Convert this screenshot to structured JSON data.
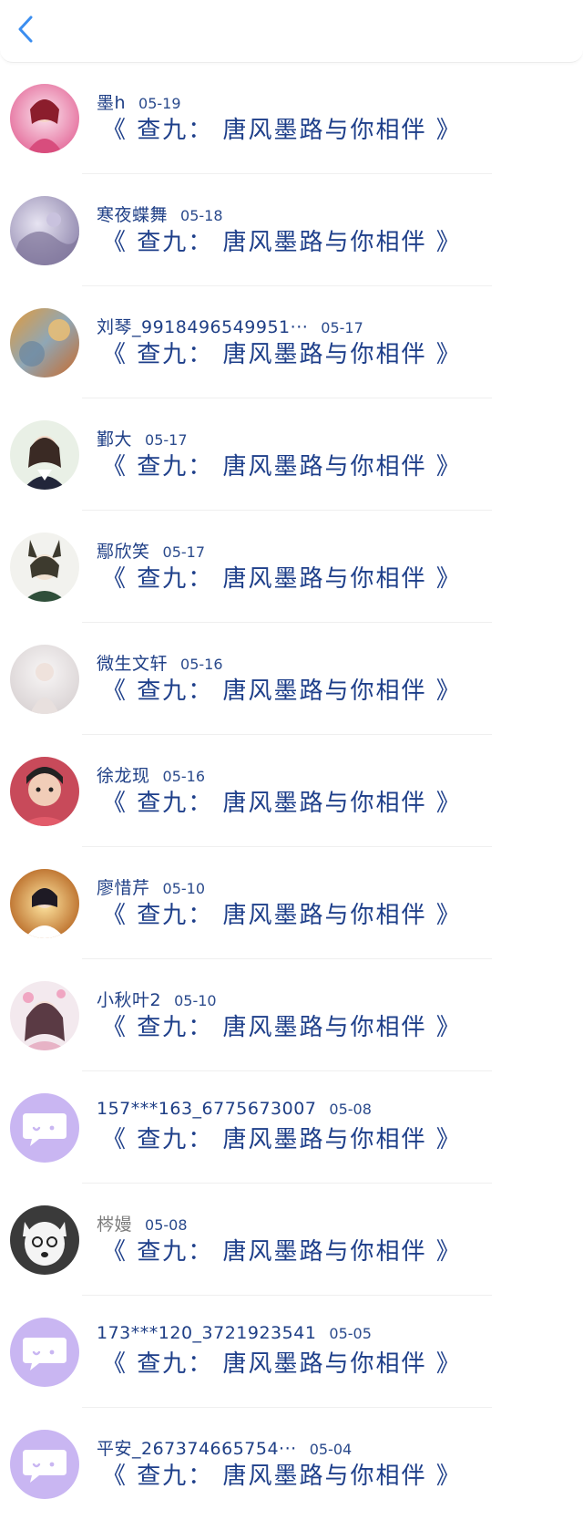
{
  "header": {
    "back_icon": "chevron-left-icon",
    "accent_color": "#3b8ef0"
  },
  "items": [
    {
      "name": "墨h",
      "date": "05-19",
      "title": "《 查九： 唐风墨路与你相伴 》",
      "avatar": "photo-pink"
    },
    {
      "name": "寒夜蝶舞",
      "date": "05-18",
      "title": "《 查九： 唐风墨路与你相伴 》",
      "avatar": "photo-lavender"
    },
    {
      "name": "刘琴_9918496549951···",
      "date": "05-17",
      "title": "《 查九： 唐风墨路与你相伴 》",
      "avatar": "photo-autumn"
    },
    {
      "name": "鄞大",
      "date": "05-17",
      "title": "《 查九： 唐风墨路与你相伴 》",
      "avatar": "photo-girl"
    },
    {
      "name": "鄢欣笑",
      "date": "05-17",
      "title": "《 查九： 唐风墨路与你相伴 》",
      "avatar": "photo-anime-fox"
    },
    {
      "name": "微生文轩",
      "date": "05-16",
      "title": "《 查九： 唐风墨路与你相伴 》",
      "avatar": "photo-pale"
    },
    {
      "name": "徐龙现",
      "date": "05-16",
      "title": "《 查九： 唐风墨路与你相伴 》",
      "avatar": "photo-child"
    },
    {
      "name": "廖惜芹",
      "date": "05-10",
      "title": "《 查九： 唐风墨路与你相伴 》",
      "avatar": "photo-gold"
    },
    {
      "name": "小秋叶2",
      "date": "05-10",
      "title": "《 查九： 唐风墨路与你相伴 》",
      "avatar": "photo-anime-girl"
    },
    {
      "name": "157***163_6775673007",
      "date": "05-08",
      "title": "《 查九： 唐风墨路与你相伴 》",
      "avatar": "default-chat-icon"
    },
    {
      "name": "梣嫚",
      "date": "05-08",
      "title": "《 查九： 唐风墨路与你相伴 》",
      "avatar": "photo-dog",
      "name_gray": true
    },
    {
      "name": "173***120_3721923541",
      "date": "05-05",
      "title": "《 查九： 唐风墨路与你相伴 》",
      "avatar": "default-chat-icon"
    },
    {
      "name": "平安_267374665754···",
      "date": "05-04",
      "title": "《 查九： 唐风墨路与你相伴 》",
      "avatar": "default-chat-icon"
    }
  ],
  "colors": {
    "name": "#1f3f86",
    "title": "#1e3f8a",
    "default_avatar_bg": "#c9b6f2"
  }
}
